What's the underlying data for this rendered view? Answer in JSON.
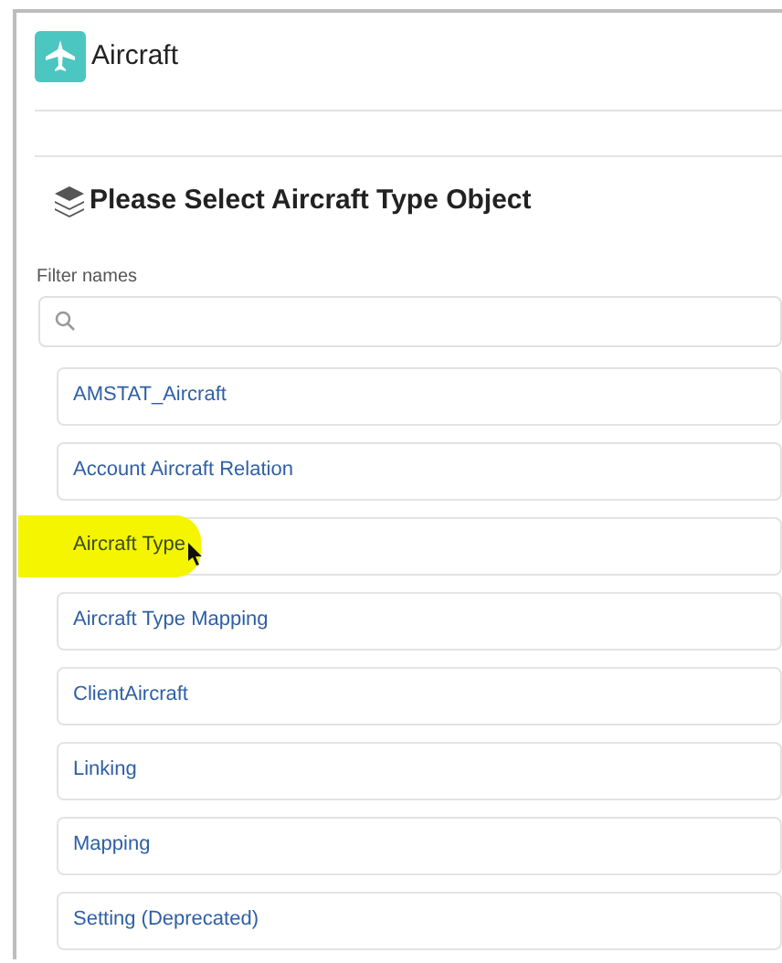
{
  "header": {
    "title": "Aircraft"
  },
  "panel": {
    "title": "Please Select Aircraft Type Object",
    "filter": {
      "label": "Filter names"
    }
  },
  "items": [
    {
      "label": "AMSTAT_Aircraft",
      "highlighted": false
    },
    {
      "label": "Account Aircraft Relation",
      "highlighted": false
    },
    {
      "label": "Aircraft Type",
      "highlighted": true
    },
    {
      "label": "Aircraft Type Mapping",
      "highlighted": false
    },
    {
      "label": "ClientAircraft",
      "highlighted": false
    },
    {
      "label": "Linking",
      "highlighted": false
    },
    {
      "label": "Mapping",
      "highlighted": false
    },
    {
      "label": "Setting (Deprecated)",
      "highlighted": false
    }
  ]
}
